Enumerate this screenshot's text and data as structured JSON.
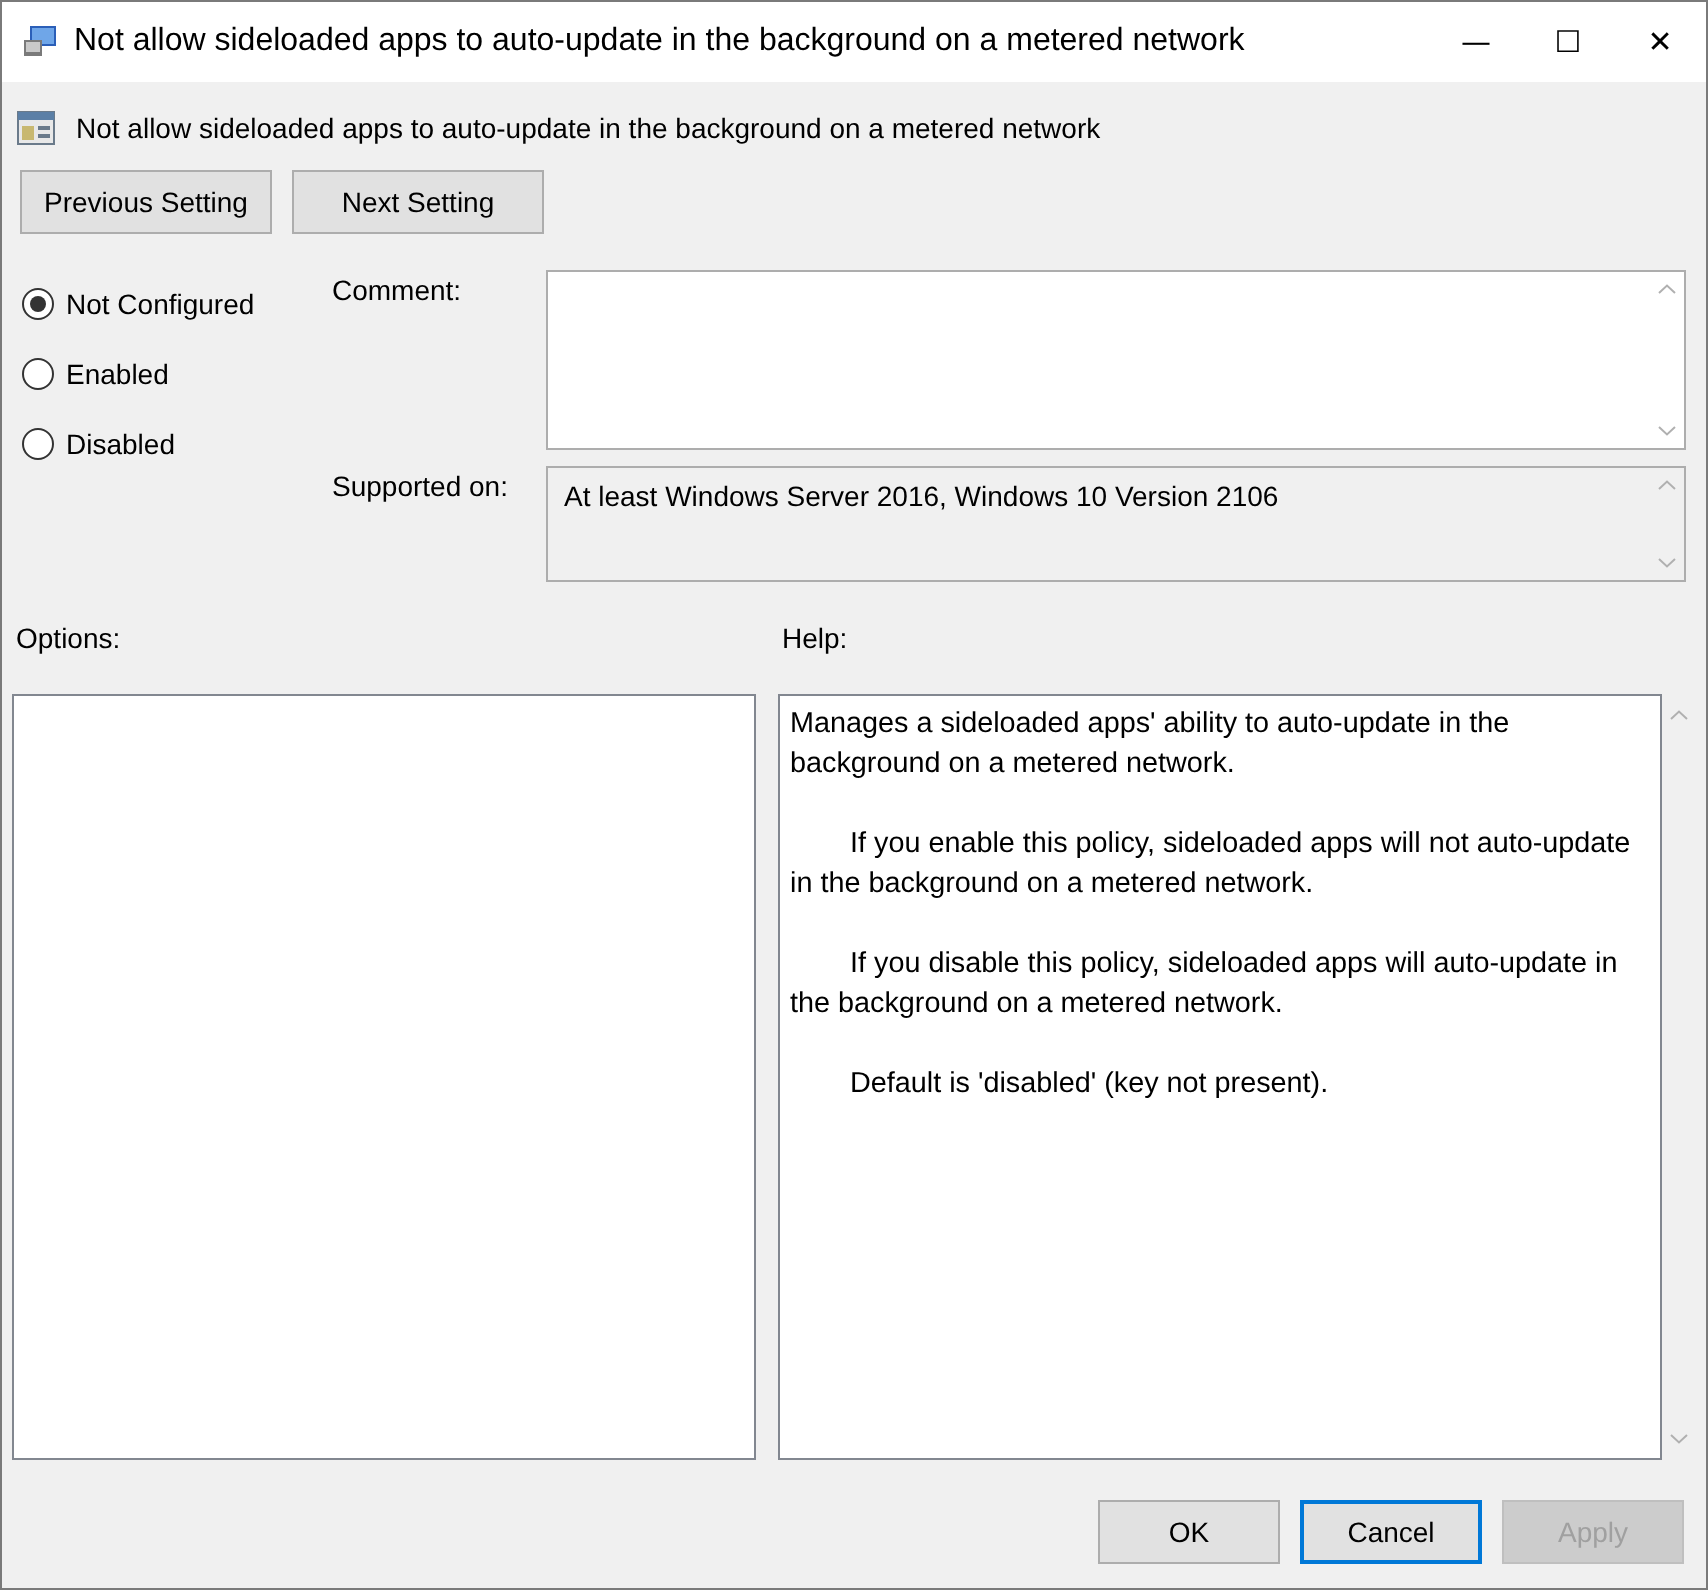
{
  "window": {
    "title": "Not allow sideloaded apps to auto-update in the background on a metered network",
    "controls": [
      "—",
      "☐",
      "✕"
    ]
  },
  "header": {
    "title": "Not allow sideloaded apps to auto-update in the background on a metered network"
  },
  "nav_buttons": [
    "Previous Setting",
    "Next Setting"
  ],
  "radios": [
    {
      "label": "Not Configured",
      "selected": true
    },
    {
      "label": "Enabled",
      "selected": false
    },
    {
      "label": "Disabled",
      "selected": false
    }
  ],
  "comment": {
    "label": "Comment:"
  },
  "supported_on": {
    "label": "Supported on:",
    "value": "At least Windows Server 2016, Windows 10 Version 2106"
  },
  "options": {
    "label": "Options:"
  },
  "help": {
    "label": "Help:",
    "paragraphs": [
      {
        "text": "Manages a sideloaded apps' ability to auto-update in the background on a metered network.",
        "indented": false
      },
      {
        "text": "If you enable this policy, sideloaded apps will not auto-update in the background on a metered network.",
        "indented": true
      },
      {
        "text": "If you disable this policy, sideloaded apps will auto-update in the background on a metered network.",
        "indented": true
      },
      {
        "text": "Default is 'disabled' (key not present).",
        "indented": true
      }
    ]
  },
  "buttons": [
    {
      "label": "OK",
      "focused": false,
      "disabled": false
    },
    {
      "label": "Cancel",
      "focused": true,
      "disabled": false
    },
    {
      "label": "Apply",
      "focused": false,
      "disabled": true
    }
  ]
}
